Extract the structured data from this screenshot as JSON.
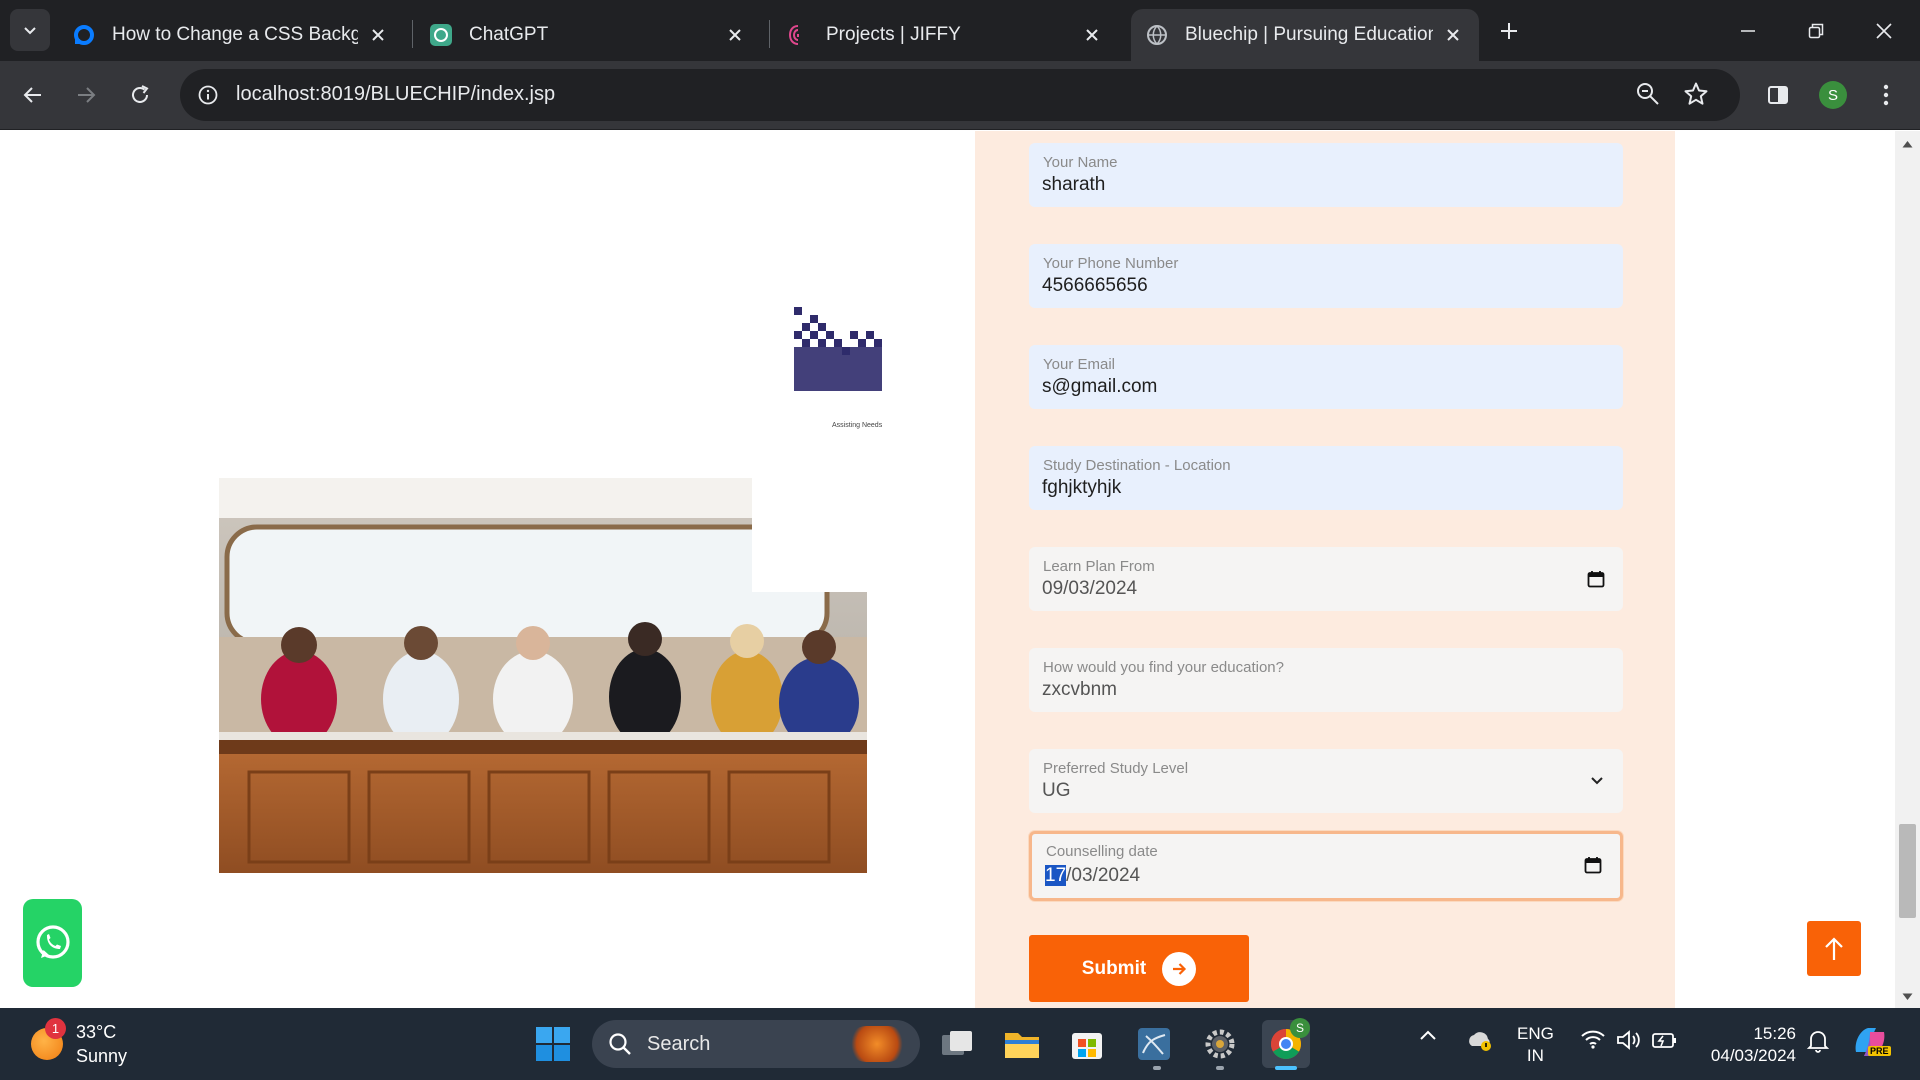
{
  "browser": {
    "tabs": [
      {
        "title": "How to Change a CSS Backgrou",
        "icon": "digitalocean-icon",
        "active": false
      },
      {
        "title": "ChatGPT",
        "icon": "chatgpt-icon",
        "active": false
      },
      {
        "title": "Projects | JIFFY",
        "icon": "jiffy-icon",
        "active": false
      },
      {
        "title": "Bluechip | Pursuing Education A",
        "icon": "globe-icon",
        "active": true
      }
    ],
    "url": "localhost:8019/BLUECHIP/index.jsp",
    "profile_initial": "S"
  },
  "page": {
    "logo": {
      "text": "BLUECHIP",
      "tagline": "Assisting Needs"
    },
    "form": {
      "fields": [
        {
          "label": "Your Name",
          "value": "sharath"
        },
        {
          "label": "Your Phone Number",
          "value": "4566665656"
        },
        {
          "label": "Your Email",
          "value": "s@gmail.com"
        },
        {
          "label": "Study Destination - Location",
          "value": "fghjktyhjk"
        },
        {
          "label": "Learn Plan From",
          "value": "09/03/2024"
        },
        {
          "label": "How would you find your education?",
          "value": "zxcvbnm"
        },
        {
          "label": "Preferred Study Level",
          "value": "UG"
        },
        {
          "label": "Counselling date",
          "value_selected": "17",
          "value_rest": "/03/2024"
        }
      ],
      "submit_label": "Submit"
    }
  },
  "taskbar": {
    "weather": {
      "temp": "33°C",
      "condition": "Sunny",
      "badge": "1"
    },
    "search_label": "Search",
    "chrome_badge": "S",
    "lang_top": "ENG",
    "lang_bottom": "IN",
    "time": "15:26",
    "date": "04/03/2024",
    "copilot_badge": "PRE"
  },
  "colors": {
    "accent": "#f96207",
    "panel": "#fdebdf",
    "autofill": "#e8f0fd",
    "logo": "#2f2b6b"
  }
}
